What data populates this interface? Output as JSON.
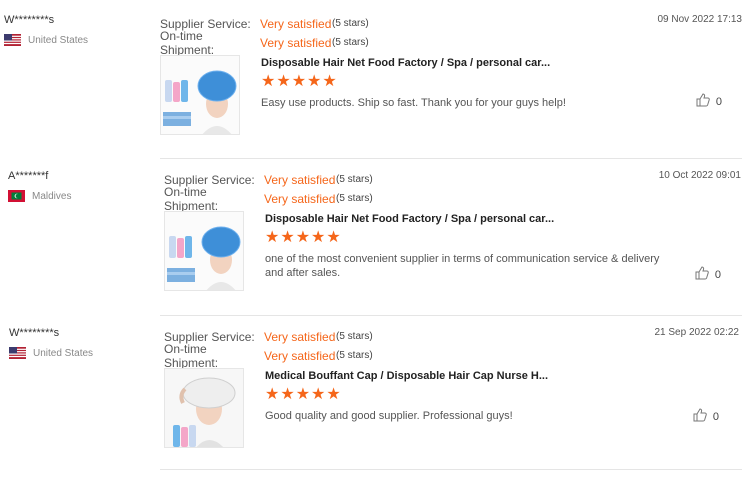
{
  "labels": {
    "supplier_service": "Supplier Service:",
    "ontime_shipment": "On-time Shipment:"
  },
  "reviews": [
    {
      "user": "W********s",
      "country": "United States",
      "flag": "us",
      "supplier_service": "Very satisfied",
      "supplier_service_stars": "(5 stars)",
      "ontime_shipment": "Very satisfied",
      "ontime_shipment_stars": "(5 stars)",
      "date": "09 Nov 2022 17:13",
      "product_title": "Disposable Hair Net Food Factory / Spa / personal car...",
      "product_rating": 5,
      "comment": "Easy use products. Ship so fast. Thank you for your guys help!",
      "likes": "0",
      "thumb_icon": "blue-hair-net-model"
    },
    {
      "user": "A*******f",
      "country": "Maldives",
      "flag": "mv",
      "supplier_service": "Very satisfied",
      "supplier_service_stars": "(5 stars)",
      "ontime_shipment": "Very satisfied",
      "ontime_shipment_stars": "(5 stars)",
      "date": "10 Oct 2022 09:01",
      "product_title": "Disposable Hair Net Food Factory / Spa / personal car...",
      "product_rating": 5,
      "comment": "one of the most convenient supplier in terms of communication service & delivery and after sales.",
      "likes": "0",
      "thumb_icon": "blue-hair-net-model"
    },
    {
      "user": "W********s",
      "country": "United States",
      "flag": "us",
      "supplier_service": "Very satisfied",
      "supplier_service_stars": "(5 stars)",
      "ontime_shipment": "Very satisfied",
      "ontime_shipment_stars": "(5 stars)",
      "date": "21 Sep 2022 02:22",
      "product_title": "Medical Bouffant Cap / Disposable Hair Cap Nurse H...",
      "product_rating": 5,
      "comment": "Good quality and good supplier. Professional guys!",
      "likes": "0",
      "thumb_icon": "white-bouffant-cap-model"
    }
  ],
  "colors": {
    "accent": "#f5661a",
    "divider": "#e5e5e5"
  }
}
